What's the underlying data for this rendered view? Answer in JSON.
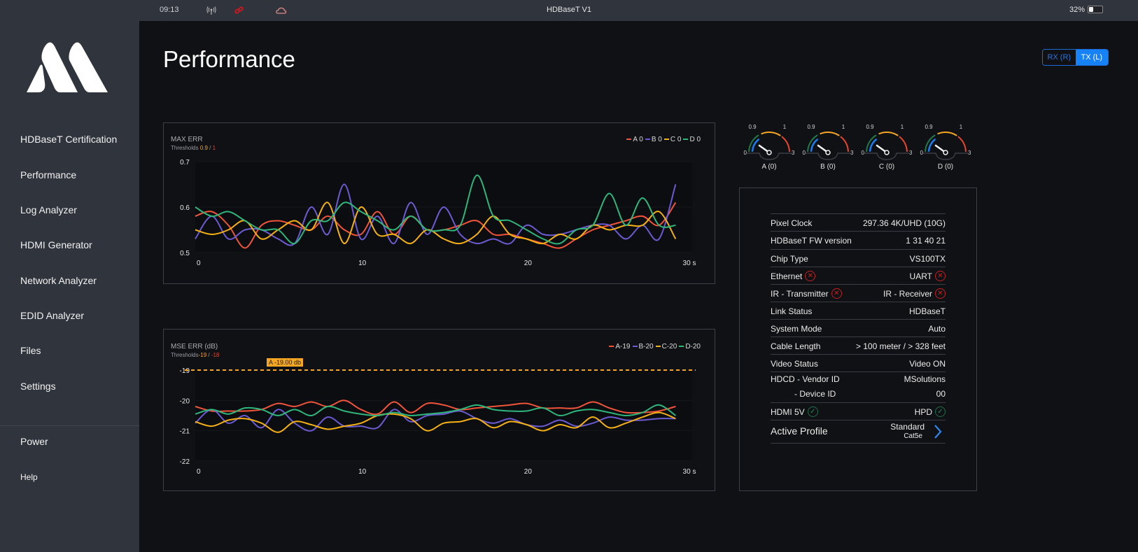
{
  "statusbar": {
    "time": "09:13",
    "icons": [
      "wireless-icon",
      "link-icon",
      "cloud-icon"
    ],
    "title": "HDBaseT V1",
    "battery_percent": "32%",
    "battery_level": 0.32
  },
  "sidebar": {
    "items": [
      {
        "label": "HDBaseT Certification"
      },
      {
        "label": "Performance"
      },
      {
        "label": "Log Analyzer"
      },
      {
        "label": "HDMI Generator"
      },
      {
        "label": "Network Analyzer"
      },
      {
        "label": "EDID Analyzer"
      },
      {
        "label": "Files"
      },
      {
        "label": "Settings"
      }
    ],
    "power": "Power",
    "help": "Help"
  },
  "page": {
    "title": "Performance",
    "toggle": {
      "rx": "RX (R)",
      "tx": "TX (L)",
      "selected": "TX (L)"
    }
  },
  "colors": {
    "A": "#f0543a",
    "B": "#6b5bd2",
    "C": "#f5b014",
    "D": "#2fb67c",
    "warn": "#f5a623",
    "crit": "#e8452c"
  },
  "chart_data": [
    {
      "type": "line",
      "title": "MAX ERR",
      "thresholds_label": "Thresholds",
      "threshold_warn": "0.9",
      "threshold_crit": "1",
      "threshold_sep": " / ",
      "xlabel": "s",
      "x_ticks": [
        "0",
        "10",
        "20",
        "30 s"
      ],
      "y_ticks": [
        "0.7",
        "0.6",
        "0.5"
      ],
      "xlim": [
        0,
        30
      ],
      "ylim": [
        0.5,
        0.7
      ],
      "legend": [
        "A 0",
        "B 0",
        "C 0",
        "D 0"
      ],
      "x": [
        0,
        1,
        2,
        3,
        4,
        5,
        6,
        7,
        8,
        9,
        10,
        11,
        12,
        13,
        14,
        15,
        16,
        17,
        18,
        19,
        20,
        21,
        22,
        23,
        24,
        25,
        26,
        27,
        28,
        29
      ],
      "series": [
        {
          "name": "A",
          "values": [
            0.58,
            0.59,
            0.56,
            0.51,
            0.56,
            0.57,
            0.56,
            0.55,
            0.58,
            0.55,
            0.54,
            0.59,
            0.54,
            0.58,
            0.55,
            0.55,
            0.56,
            0.57,
            0.54,
            0.54,
            0.53,
            0.52,
            0.51,
            0.53,
            0.55,
            0.56,
            0.57,
            0.58,
            0.56,
            0.61
          ]
        },
        {
          "name": "B",
          "values": [
            0.53,
            0.58,
            0.53,
            0.55,
            0.55,
            0.53,
            0.52,
            0.6,
            0.54,
            0.65,
            0.53,
            0.58,
            0.52,
            0.61,
            0.54,
            0.6,
            0.54,
            0.52,
            0.53,
            0.52,
            0.56,
            0.54,
            0.54,
            0.55,
            0.56,
            0.56,
            0.53,
            0.56,
            0.53,
            0.65
          ]
        },
        {
          "name": "C",
          "values": [
            0.55,
            0.54,
            0.55,
            0.57,
            0.53,
            0.55,
            0.57,
            0.55,
            0.61,
            0.52,
            0.6,
            0.54,
            0.54,
            0.52,
            0.55,
            0.53,
            0.52,
            0.54,
            0.58,
            0.54,
            0.53,
            0.52,
            0.54,
            0.53,
            0.56,
            0.55,
            0.56,
            0.56,
            0.59,
            0.53
          ]
        },
        {
          "name": "D",
          "values": [
            0.6,
            0.58,
            0.59,
            0.57,
            0.55,
            0.55,
            0.52,
            0.57,
            0.57,
            0.61,
            0.59,
            0.57,
            0.55,
            0.58,
            0.55,
            0.55,
            0.56,
            0.67,
            0.58,
            0.57,
            0.55,
            0.53,
            0.52,
            0.55,
            0.56,
            0.63,
            0.56,
            0.62,
            0.56,
            0.56
          ]
        }
      ]
    },
    {
      "type": "line",
      "title": "MSE ERR (dB)",
      "thresholds_label": "Thresholds",
      "threshold_warn": "-19",
      "threshold_crit": "-18",
      "threshold_sep": " / ",
      "xlabel": "s",
      "x_ticks": [
        "0",
        "10",
        "20",
        "30 s"
      ],
      "y_ticks": [
        "-19",
        "-20",
        "-21",
        "-22"
      ],
      "xlim": [
        0,
        30
      ],
      "ylim": [
        -22,
        -19
      ],
      "legend": [
        "A-19",
        "B-20",
        "C-20",
        "D-20"
      ],
      "annotation": {
        "text": "A -19.00 db",
        "y": -19
      },
      "x": [
        0,
        1,
        2,
        3,
        4,
        5,
        6,
        7,
        8,
        9,
        10,
        11,
        12,
        13,
        14,
        15,
        16,
        17,
        18,
        19,
        20,
        21,
        22,
        23,
        24,
        25,
        26,
        27,
        28,
        29
      ],
      "series": [
        {
          "name": "A",
          "values": [
            -20.2,
            -20.35,
            -20.35,
            -20.35,
            -20.3,
            -20.1,
            -20.2,
            -20.05,
            -20.2,
            -20.0,
            -20.3,
            -20.45,
            -20.05,
            -20.4,
            -20.1,
            -20.15,
            -20.3,
            -20.25,
            -20.2,
            -20.15,
            -20.1,
            -20.25,
            -20.25,
            -20.25,
            -20.05,
            -20.25,
            -20.4,
            -20.4,
            -20.35,
            -20.2
          ]
        },
        {
          "name": "B",
          "values": [
            -20.75,
            -20.3,
            -20.75,
            -20.5,
            -20.9,
            -20.3,
            -20.75,
            -21.0,
            -20.55,
            -20.85,
            -20.85,
            -20.9,
            -20.3,
            -20.7,
            -20.5,
            -20.45,
            -20.35,
            -20.6,
            -20.75,
            -20.6,
            -20.8,
            -20.85,
            -20.65,
            -20.85,
            -20.75,
            -20.55,
            -20.65,
            -20.65,
            -20.6,
            -20.6
          ]
        },
        {
          "name": "C",
          "values": [
            -20.7,
            -20.85,
            -20.65,
            -20.6,
            -20.75,
            -21.05,
            -20.7,
            -20.8,
            -20.95,
            -20.85,
            -20.75,
            -20.5,
            -20.45,
            -20.6,
            -21.0,
            -20.75,
            -20.7,
            -20.6,
            -20.9,
            -20.7,
            -20.8,
            -21.0,
            -20.8,
            -20.9,
            -20.55,
            -20.9,
            -20.75,
            -20.55,
            -20.4,
            -20.6
          ]
        },
        {
          "name": "D",
          "values": [
            -20.45,
            -20.3,
            -20.45,
            -20.25,
            -20.3,
            -20.5,
            -20.3,
            -20.5,
            -20.2,
            -20.35,
            -20.45,
            -20.5,
            -20.4,
            -20.5,
            -20.45,
            -20.4,
            -20.3,
            -20.15,
            -20.3,
            -20.35,
            -20.35,
            -20.25,
            -20.5,
            -20.35,
            -20.3,
            -20.4,
            -20.5,
            -20.4,
            -20.15,
            -20.5
          ]
        }
      ]
    }
  ],
  "gauges": [
    {
      "label": "A (0)",
      "value": 0
    },
    {
      "label": "B (0)",
      "value": 0
    },
    {
      "label": "C (0)",
      "value": 0
    },
    {
      "label": "D (0)",
      "value": 0
    }
  ],
  "gauge_scale": {
    "min": "0",
    "warn": "0.9",
    "crit": "1",
    "max": "3"
  },
  "info": {
    "pixel_clock": {
      "k": "Pixel Clock",
      "v": "297.36 4K/UHD (10G)"
    },
    "fw": {
      "k": "HDBaseT FW version",
      "v": "1 31 40 21"
    },
    "chip": {
      "k": "Chip Type",
      "v": "VS100TX"
    },
    "ethernet": {
      "k": "Ethernet",
      "status": "error"
    },
    "uart": {
      "k": "UART",
      "status": "error"
    },
    "ir_tx": {
      "k": "IR - Transmitter",
      "status": "error"
    },
    "ir_rx": {
      "k": "IR - Receiver",
      "status": "error"
    },
    "link": {
      "k": "Link Status",
      "v": "HDBaseT"
    },
    "mode": {
      "k": "System Mode",
      "v": "Auto"
    },
    "cable": {
      "k": "Cable Length",
      "v": "> 100 meter / > 328 feet"
    },
    "video": {
      "k": "Video Status",
      "v": "Video ON"
    },
    "vendor": {
      "k": "HDCD - Vendor ID",
      "v": "MSolutions"
    },
    "device": {
      "k": "- Device ID",
      "v": "00"
    },
    "hdmi5v": {
      "k": "HDMI 5V",
      "status": "ok"
    },
    "hpd": {
      "k": "HPD",
      "status": "ok"
    },
    "profile": {
      "k": "Active Profile",
      "v": "Standard",
      "sub": "Cat5e"
    }
  }
}
